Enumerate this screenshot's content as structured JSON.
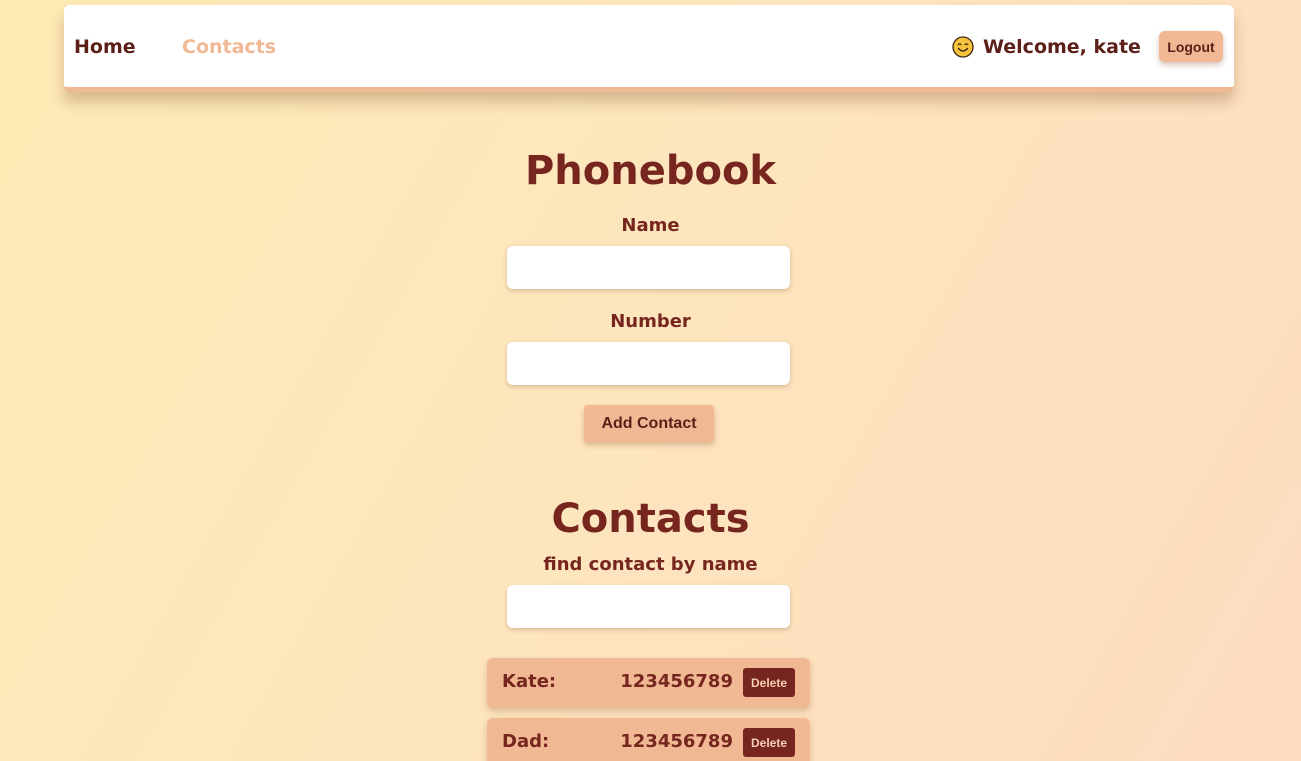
{
  "nav": {
    "home_label": "Home",
    "contacts_label": "Contacts",
    "welcome_text": "Welcome, kate",
    "logout_label": "Logout",
    "smile_icon": "smiling-face-icon"
  },
  "form": {
    "title": "Phonebook",
    "name_label": "Name",
    "name_value": "",
    "number_label": "Number",
    "number_value": "",
    "submit_label": "Add Contact"
  },
  "contacts": {
    "title": "Contacts",
    "filter_label": "find contact by name",
    "filter_value": "",
    "delete_label": "Delete",
    "items": [
      {
        "name": "Kate:",
        "number": "123456789"
      },
      {
        "name": "Dad:",
        "number": "123456789"
      }
    ]
  },
  "colors": {
    "accent": "#f0b893",
    "text": "#76261f",
    "background_start": "#fdeab4",
    "background_end": "#fcdcc0"
  }
}
